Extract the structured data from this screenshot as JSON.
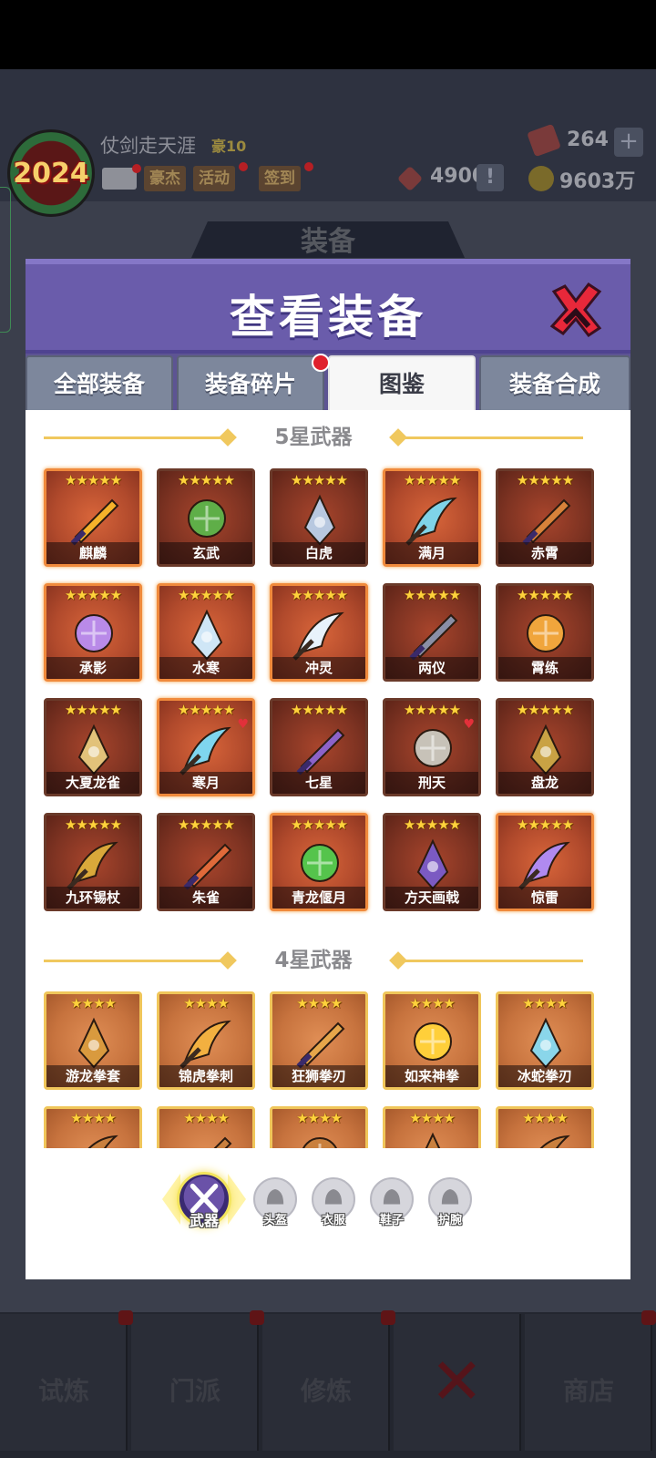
{
  "player": {
    "name": "仗剑走天涯",
    "vip": "豪10",
    "avatar_year": "2024"
  },
  "header_buttons": [
    "豪杰",
    "活动",
    "签到"
  ],
  "resources": {
    "gems": "264",
    "tokens": "4900",
    "gold": "9603万"
  },
  "screen_section": "装备",
  "modal": {
    "title": "查看装备",
    "tabs": [
      "全部装备",
      "装备碎片",
      "图鉴",
      "装备合成"
    ],
    "active_tab": "图鉴",
    "sections": [
      {
        "title": "5星武器",
        "stars": "★★★★★",
        "items": [
          {
            "name": "麒麟",
            "glow": true,
            "icon": "sun-fan-weapon-icon",
            "color": "#f5b22a"
          },
          {
            "name": "玄武",
            "glow": false,
            "icon": "turtle-shield-icon",
            "color": "#5fae48"
          },
          {
            "name": "白虎",
            "glow": false,
            "icon": "tiger-mask-icon",
            "color": "#b8c8e0"
          },
          {
            "name": "满月",
            "glow": true,
            "icon": "moon-ring-icon",
            "color": "#7fd3e8"
          },
          {
            "name": "赤霄",
            "glow": false,
            "icon": "red-sword-icon",
            "color": "#d8823a"
          },
          {
            "name": "承影",
            "glow": true,
            "icon": "purple-sword-icon",
            "color": "#b98ae8"
          },
          {
            "name": "水寒",
            "glow": true,
            "icon": "ice-sword-icon",
            "color": "#cfe6f6"
          },
          {
            "name": "冲灵",
            "glow": true,
            "icon": "spirit-sword-icon",
            "color": "#e8f2fb"
          },
          {
            "name": "两仪",
            "glow": false,
            "icon": "dark-sword-icon",
            "color": "#8a8fa6"
          },
          {
            "name": "霄练",
            "glow": false,
            "icon": "flame-sword-icon",
            "color": "#f0a53c"
          },
          {
            "name": "大夏龙雀",
            "glow": false,
            "icon": "dragon-blade-icon",
            "color": "#e2c27a"
          },
          {
            "name": "寒月",
            "glow": true,
            "icon": "frost-blade-icon",
            "color": "#7fd6ef",
            "heart": true
          },
          {
            "name": "七星",
            "glow": false,
            "icon": "seven-star-blade-icon",
            "color": "#8c63c9"
          },
          {
            "name": "刑天",
            "glow": false,
            "icon": "battle-axe-icon",
            "color": "#c7c2b8",
            "heart": true
          },
          {
            "name": "盘龙",
            "glow": false,
            "icon": "dragon-staff-icon",
            "color": "#c9a244"
          },
          {
            "name": "九环锡杖",
            "glow": false,
            "icon": "ring-staff-icon",
            "color": "#d9a83a"
          },
          {
            "name": "朱雀",
            "glow": false,
            "icon": "phoenix-spear-icon",
            "color": "#e06a3a"
          },
          {
            "name": "青龙偃月",
            "glow": true,
            "icon": "green-glaive-icon",
            "color": "#55c44c"
          },
          {
            "name": "方天画戟",
            "glow": false,
            "icon": "halberd-icon",
            "color": "#7b5ac2"
          },
          {
            "name": "惊雷",
            "glow": true,
            "icon": "thunder-staff-icon",
            "color": "#b08af0"
          }
        ]
      },
      {
        "title": "4星武器",
        "stars": "★★★★",
        "items": [
          {
            "name": "游龙拳套",
            "icon": "dragon-gauntlet-icon",
            "color": "#d99a3e"
          },
          {
            "name": "锦虎拳刺",
            "icon": "tiger-claw-icon",
            "color": "#f2b040"
          },
          {
            "name": "狂狮拳刃",
            "icon": "lion-fist-blade-icon",
            "color": "#e6a64a"
          },
          {
            "name": "如来神拳",
            "icon": "golden-fist-icon",
            "color": "#ffcf3a"
          },
          {
            "name": "冰蛇拳刃",
            "icon": "ice-snake-claw-icon",
            "color": "#8ad6ea"
          },
          {
            "name": "",
            "icon": "weapon-icon",
            "color": "#c9803e"
          },
          {
            "name": "",
            "icon": "weapon-icon",
            "color": "#c9803e"
          },
          {
            "name": "",
            "icon": "weapon-icon",
            "color": "#c9803e"
          },
          {
            "name": "",
            "icon": "weapon-icon",
            "color": "#c9803e"
          },
          {
            "name": "",
            "icon": "weapon-icon",
            "color": "#c9803e"
          }
        ]
      }
    ],
    "categories": [
      {
        "label": "武器",
        "icon": "crossed-swords-icon",
        "active": true
      },
      {
        "label": "头盔",
        "icon": "helmet-icon",
        "active": false
      },
      {
        "label": "衣服",
        "icon": "armor-icon",
        "active": false
      },
      {
        "label": "鞋子",
        "icon": "boots-icon",
        "active": false
      },
      {
        "label": "护腕",
        "icon": "bracer-icon",
        "active": false
      }
    ]
  },
  "bottom_nav": [
    "试炼",
    "门派",
    "修炼",
    "",
    "商店"
  ],
  "colors": {
    "modal_header": "#6a5cab",
    "tab_inactive": "#7d879c",
    "five_star_card": "#a8452c",
    "four_star_card": "#e08e55",
    "star_gold": "#ffd23c"
  }
}
